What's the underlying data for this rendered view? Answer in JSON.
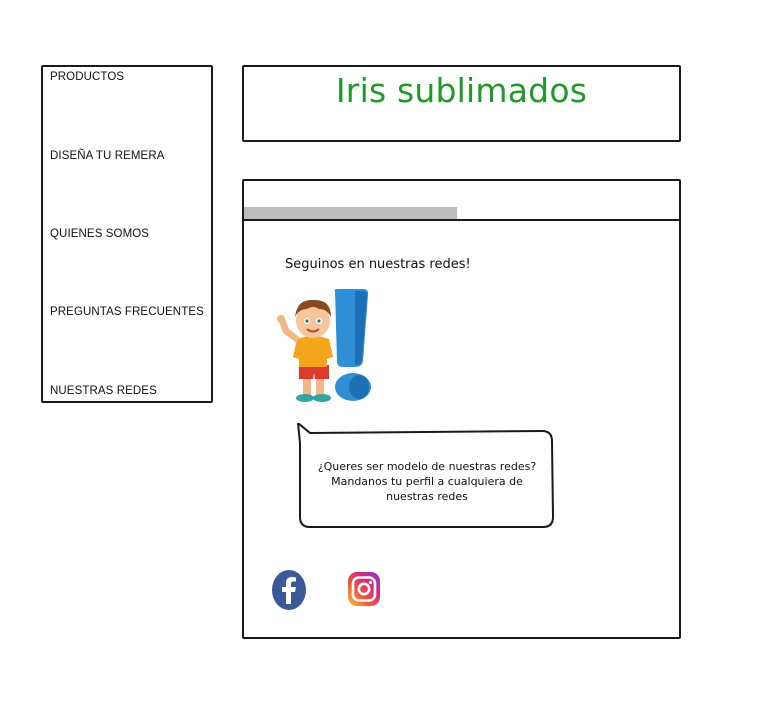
{
  "sidebar": {
    "items": [
      {
        "label": "PRODUCTOS"
      },
      {
        "label": "DISEÑA TU REMERA"
      },
      {
        "label": "QUIENES SOMOS"
      },
      {
        "label": "PREGUNTAS FRECUENTES"
      },
      {
        "label": "NUESTRAS REDES"
      }
    ]
  },
  "header": {
    "title": "Iris sublimados"
  },
  "panel": {
    "follow_text": "Seguinos en nuestras redes!",
    "progress": 0.49,
    "bubble": {
      "line1": "¿Queres ser modelo de nuestras redes?",
      "line2": "Mandanos tu perfil a cualquiera de nuestras redes"
    },
    "icons": {
      "illustration": "boy-exclamation-illustration",
      "facebook": "facebook-icon",
      "instagram": "instagram-icon"
    }
  },
  "colors": {
    "title_green": "#1f9a2a",
    "progress_fill": "#bdbdbd",
    "facebook_blue": "#3b5998"
  }
}
